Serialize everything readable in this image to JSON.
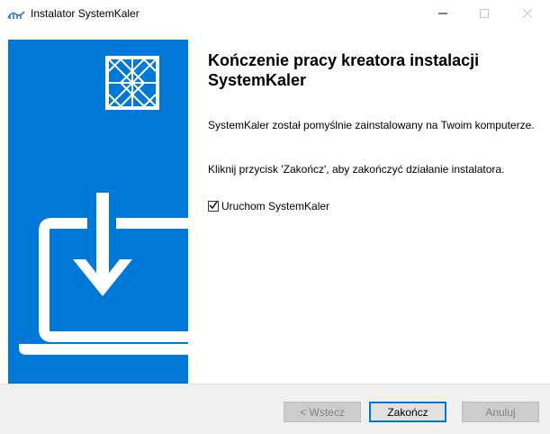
{
  "window": {
    "title": "Instalator SystemKaler",
    "accent_color": "#0078d7"
  },
  "titlebar": {
    "app_icon": "systemkaler-logo-icon",
    "minimize_icon": "minimize-icon",
    "maximize_icon": "maximize-icon",
    "close_icon": "close-icon"
  },
  "banner": {
    "logo_icon": "systemkaler-pattern-logo-icon",
    "illustration": "laptop-download-icon"
  },
  "content": {
    "heading": "Kończenie pracy kreatora instalacji SystemKaler",
    "paragraph1": "SystemKaler został pomyślnie zainstalowany na Twoim komputerze.",
    "paragraph2": "Kliknij przycisk 'Zakończ', aby zakończyć działanie instalatora.",
    "launch_checkbox": {
      "label": "Uruchom SystemKaler",
      "checked": true
    }
  },
  "footer": {
    "back_label": "< Wstecz",
    "finish_label": "Zakończ",
    "cancel_label": "Anuluj"
  }
}
